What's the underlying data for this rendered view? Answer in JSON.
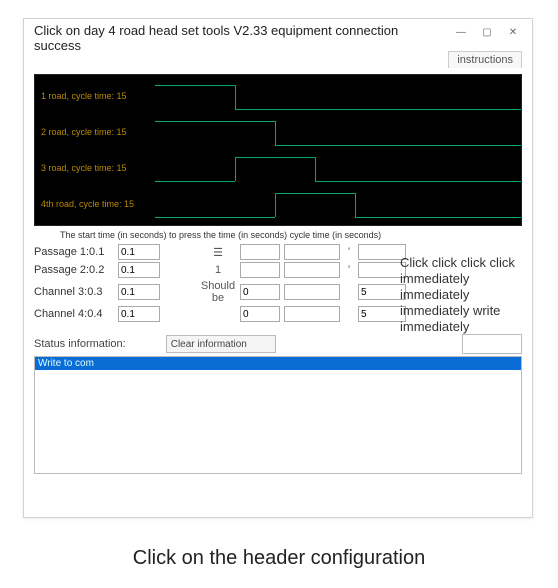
{
  "window": {
    "title": "Click on day 4 road head set tools V2.33 equipment connection success",
    "tab_label": "instructions"
  },
  "scope": {
    "rows": [
      "1 road, cycle time: 15",
      "2 road, cycle time: 15",
      "3 road, cycle time: 15",
      "4th road, cycle time: 15"
    ]
  },
  "legend": "The start time (in seconds) to press the time (in seconds) cycle time (in seconds)",
  "channels": {
    "rows": [
      {
        "label": "Passage 1:0.1",
        "v1": "0.1",
        "mid": "☰",
        "v2": "",
        "v3": "'",
        "v4": ""
      },
      {
        "label": "Passage 2:0.2",
        "v1": "0.1",
        "mid": "1",
        "v2": "",
        "v3": "'",
        "v4": ""
      },
      {
        "label": "Channel 3:0.3",
        "v1": "0.1",
        "mid": "Should be",
        "v2": "0",
        "v3": "",
        "v4": "5"
      },
      {
        "label": "Channel 4:0.4",
        "v1": "0.1",
        "mid": "",
        "v2": "0",
        "v3": "",
        "v4": "5"
      }
    ]
  },
  "side_note": "Click click click click immediately immediately immediately write immediately",
  "status": {
    "label": "Status information:",
    "clear_button": "Clear information",
    "log_line": "Write to com"
  },
  "caption": "Click on the header configuration",
  "chart_data": {
    "type": "line",
    "title": "4-channel timing waveform",
    "x_unit": "seconds",
    "cycle_time": 15,
    "series": [
      {
        "name": "1 road",
        "cycle_time": 15,
        "high_start": 0,
        "high_end": 5
      },
      {
        "name": "2 road",
        "cycle_time": 15,
        "high_start": 0,
        "high_end": 7
      },
      {
        "name": "3 road",
        "cycle_time": 15,
        "high_start": 5,
        "high_end": 9
      },
      {
        "name": "4th road",
        "cycle_time": 15,
        "high_start": 7,
        "high_end": 11
      }
    ]
  }
}
